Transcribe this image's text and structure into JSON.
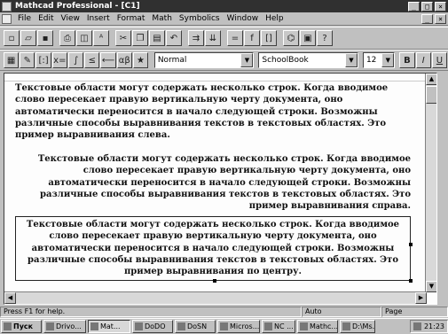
{
  "window": {
    "title": "Mathcad Professional - [C1]",
    "controls": [
      "_",
      "□",
      "×"
    ]
  },
  "menubar": {
    "items": [
      "File",
      "Edit",
      "View",
      "Insert",
      "Format",
      "Math",
      "Symbolics",
      "Window",
      "Help"
    ],
    "mdi_controls": [
      "_",
      "×"
    ]
  },
  "toolbar1": {
    "icons": [
      "new-document-icon",
      "open-icon",
      "save-icon",
      "print-icon",
      "print-preview-icon",
      "spell-check-icon",
      "cut-icon",
      "copy-icon",
      "paste-icon",
      "undo-icon",
      "align-across-icon",
      "align-down-icon",
      "calculate-icon",
      "insert-function-icon",
      "insert-unit-icon",
      "component-icon",
      "resource-center-icon",
      "help-icon"
    ],
    "glyphs": [
      "▫",
      "▱",
      "▪",
      "⎙",
      "◫",
      "ᴬ",
      "✂",
      "❐",
      "▤",
      "↶",
      "⇉",
      "⇊",
      "=",
      "f",
      "[]",
      "⌬",
      "▣",
      "?"
    ]
  },
  "toolbar2": {
    "icons": [
      "calculator-icon",
      "graph-icon",
      "matrix-icon",
      "evaluation-icon",
      "calculus-icon",
      "boolean-icon",
      "programming-icon",
      "greek-icon",
      "symbolic-icon"
    ],
    "glyphs": [
      "▦",
      "✎",
      "[:]",
      "x=",
      "∫",
      "≤",
      "⟵",
      "αβ",
      "★"
    ],
    "style_value": "Normal",
    "font_value": "SchoolBook",
    "size_value": "12",
    "format_buttons": [
      "B",
      "I",
      "U"
    ]
  },
  "document": {
    "regions": [
      {
        "align": "left",
        "text": "Текстовые области могут содержать несколько строк. Когда вводимое слово пересекает правую вертикальную черту документа, оно автоматически переносится в начало следующей строки. Возможны различные способы выравнивания текстов в текстовых областях. Это пример выравнивания слева."
      },
      {
        "align": "right",
        "text": "Текстовые области могут содержать несколько строк. Когда вводимое слово пересекает правую вертикальную черту документа, оно автоматически переносится в начало следующей строки. Возможны различные способы выравнивания текстов в текстовых областях. Это пример выравнивания справа."
      },
      {
        "align": "center",
        "text": "Текстовые области могут содержать несколько строк. Когда вводимое слово пересекает правую вертикальную черту документа, оно автоматически переносится в начало следующей строки. Возможны различные способы выравнивания текстов в текстовых областях. Это пример выравнивания по центру."
      }
    ]
  },
  "statusbar": {
    "help": "Press F1 for help.",
    "mode": "Auto",
    "page": "Page"
  },
  "taskbar": {
    "start": "Пуск",
    "tasks": [
      "Drivo...",
      "Mat...",
      "DoDO",
      "DoSN",
      "Micros...",
      "NC ...",
      "Mathc...",
      "D:\\Ms..."
    ],
    "active_index": 1,
    "clock": "21:23"
  }
}
